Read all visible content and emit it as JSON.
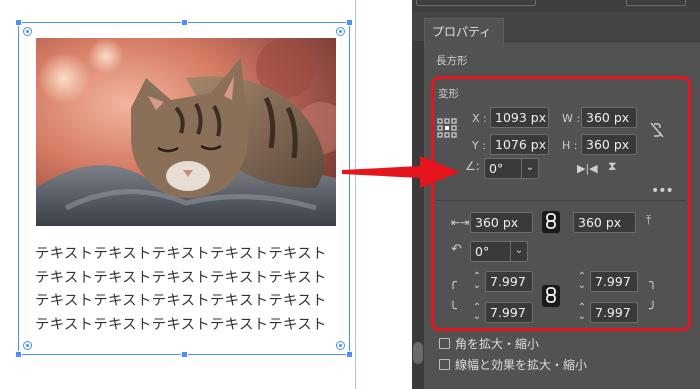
{
  "canvas": {
    "photo_alt": "cat sleeping on blanket",
    "body_text": "テキストテキストテキストテキストテキストテキストテキストテキストテキストテキストテキストテキストテキストテキストテキストテキストテキストテキストテキストテキスト"
  },
  "panel": {
    "tab_label": "プロパティ",
    "section_title": "長方形",
    "transform_title": "変形",
    "x_label": "X :",
    "x_value": "1093 px",
    "y_label": "Y :",
    "y_value": "1076 px",
    "w_label": "W :",
    "w_value": "360 px",
    "h_label": "H :",
    "h_value": "360 px",
    "rotation_value": "0°",
    "width_value": "360 px",
    "height_value": "360 px",
    "shear_value": "0°",
    "corner_tl": "7.997",
    "corner_tr": "7.997",
    "corner_bl": "7.997",
    "corner_br": "7.997",
    "scale_corners_label": "角を拡大・縮小",
    "scale_strokes_label": "線幅と効果を拡大・縮小"
  },
  "colors": {
    "selection_blue": "#4a90f5",
    "highlight_red": "#e5141d",
    "panel_bg": "#525252"
  },
  "icons": {
    "reference_point": "reference-point-icon",
    "constrain_link": "link-icon",
    "more": "more-options-icon"
  }
}
